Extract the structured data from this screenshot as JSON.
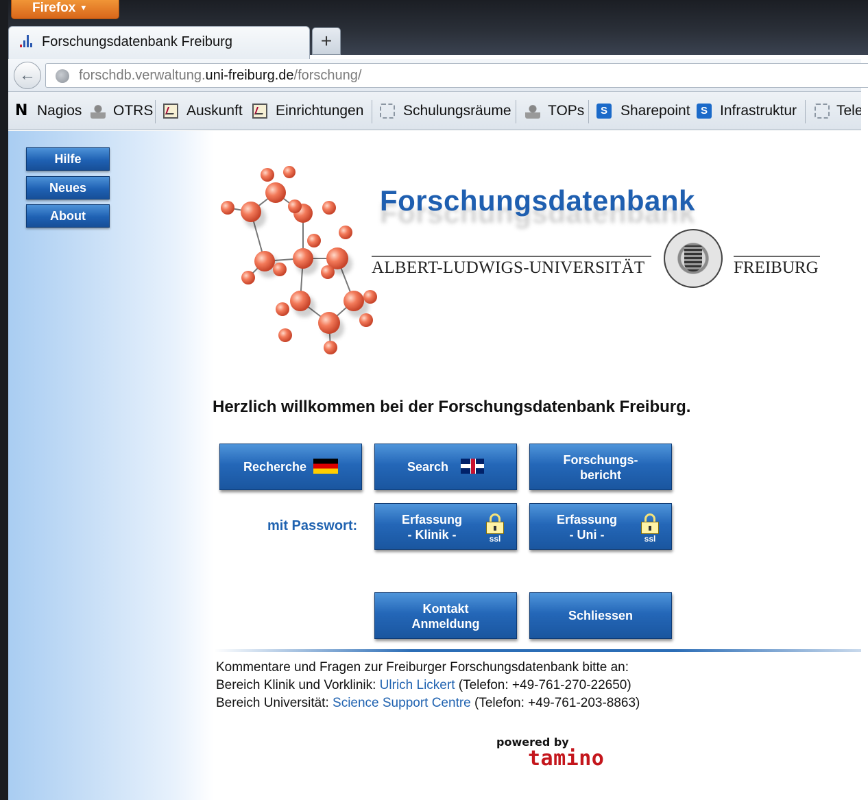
{
  "browser": {
    "menu_button": "Firefox",
    "tab_title": "Forschungsdatenbank Freiburg",
    "new_tab": "+",
    "url_prefix": "forschdb.verwaltung.",
    "url_domain": "uni-freiburg.de",
    "url_path": "/forschung/",
    "bookmarks": [
      {
        "label": "Nagios",
        "icon": "nagios-icon"
      },
      {
        "label": "OTRS",
        "icon": "person-icon"
      },
      {
        "label": "Auskunft",
        "icon": "chart-icon"
      },
      {
        "label": "Einrichtungen",
        "icon": "chart-icon"
      },
      {
        "label": "Schulungsräume",
        "icon": "page-icon"
      },
      {
        "label": "TOPs",
        "icon": "person-icon"
      },
      {
        "label": "Sharepoint",
        "icon": "sharepoint-icon"
      },
      {
        "label": "Infrastruktur",
        "icon": "sharepoint-icon"
      },
      {
        "label": "Tele",
        "icon": "page-icon"
      }
    ]
  },
  "sidebar": {
    "buttons": [
      "Hilfe",
      "Neues",
      "About"
    ]
  },
  "logo": {
    "title": "Forschungsdatenbank",
    "university_left": "ALBERT-LUDWIGS-UNIVERSITÄT",
    "university_right": "FREIBURG"
  },
  "main": {
    "welcome": "Herzlich willkommen bei der Forschungsdatenbank Freiburg.",
    "recherche": "Recherche",
    "search": "Search",
    "forschungsbericht_1": "Forschungs-",
    "forschungsbericht_2": "bericht",
    "password_label": "mit Passwort:",
    "erfassung_klinik_1": "Erfassung",
    "erfassung_klinik_2": "- Klinik -",
    "erfassung_uni_1": "Erfassung",
    "erfassung_uni_2": "- Uni -",
    "ssl": "ssl",
    "kontakt_1": "Kontakt",
    "kontakt_2": "Anmeldung",
    "schliessen": "Schliessen"
  },
  "footer": {
    "line1": "Kommentare und Fragen zur Freiburger Forschungsdatenbank bitte an:",
    "line2_prefix": "Bereich Klinik und Vorklinik: ",
    "line2_link": "Ulrich Lickert",
    "line2_suffix": " (Telefon: +49-761-270-22650)",
    "line3_prefix": "Bereich Universität: ",
    "line3_link": "Science Support Centre",
    "line3_suffix": " (Telefon: +49-761-203-8863)",
    "powered_by": "powered by",
    "tamino": "tamino"
  },
  "colors": {
    "button_blue": "#2467b8",
    "link_blue": "#1f62b0",
    "tamino_red": "#c4161c"
  }
}
